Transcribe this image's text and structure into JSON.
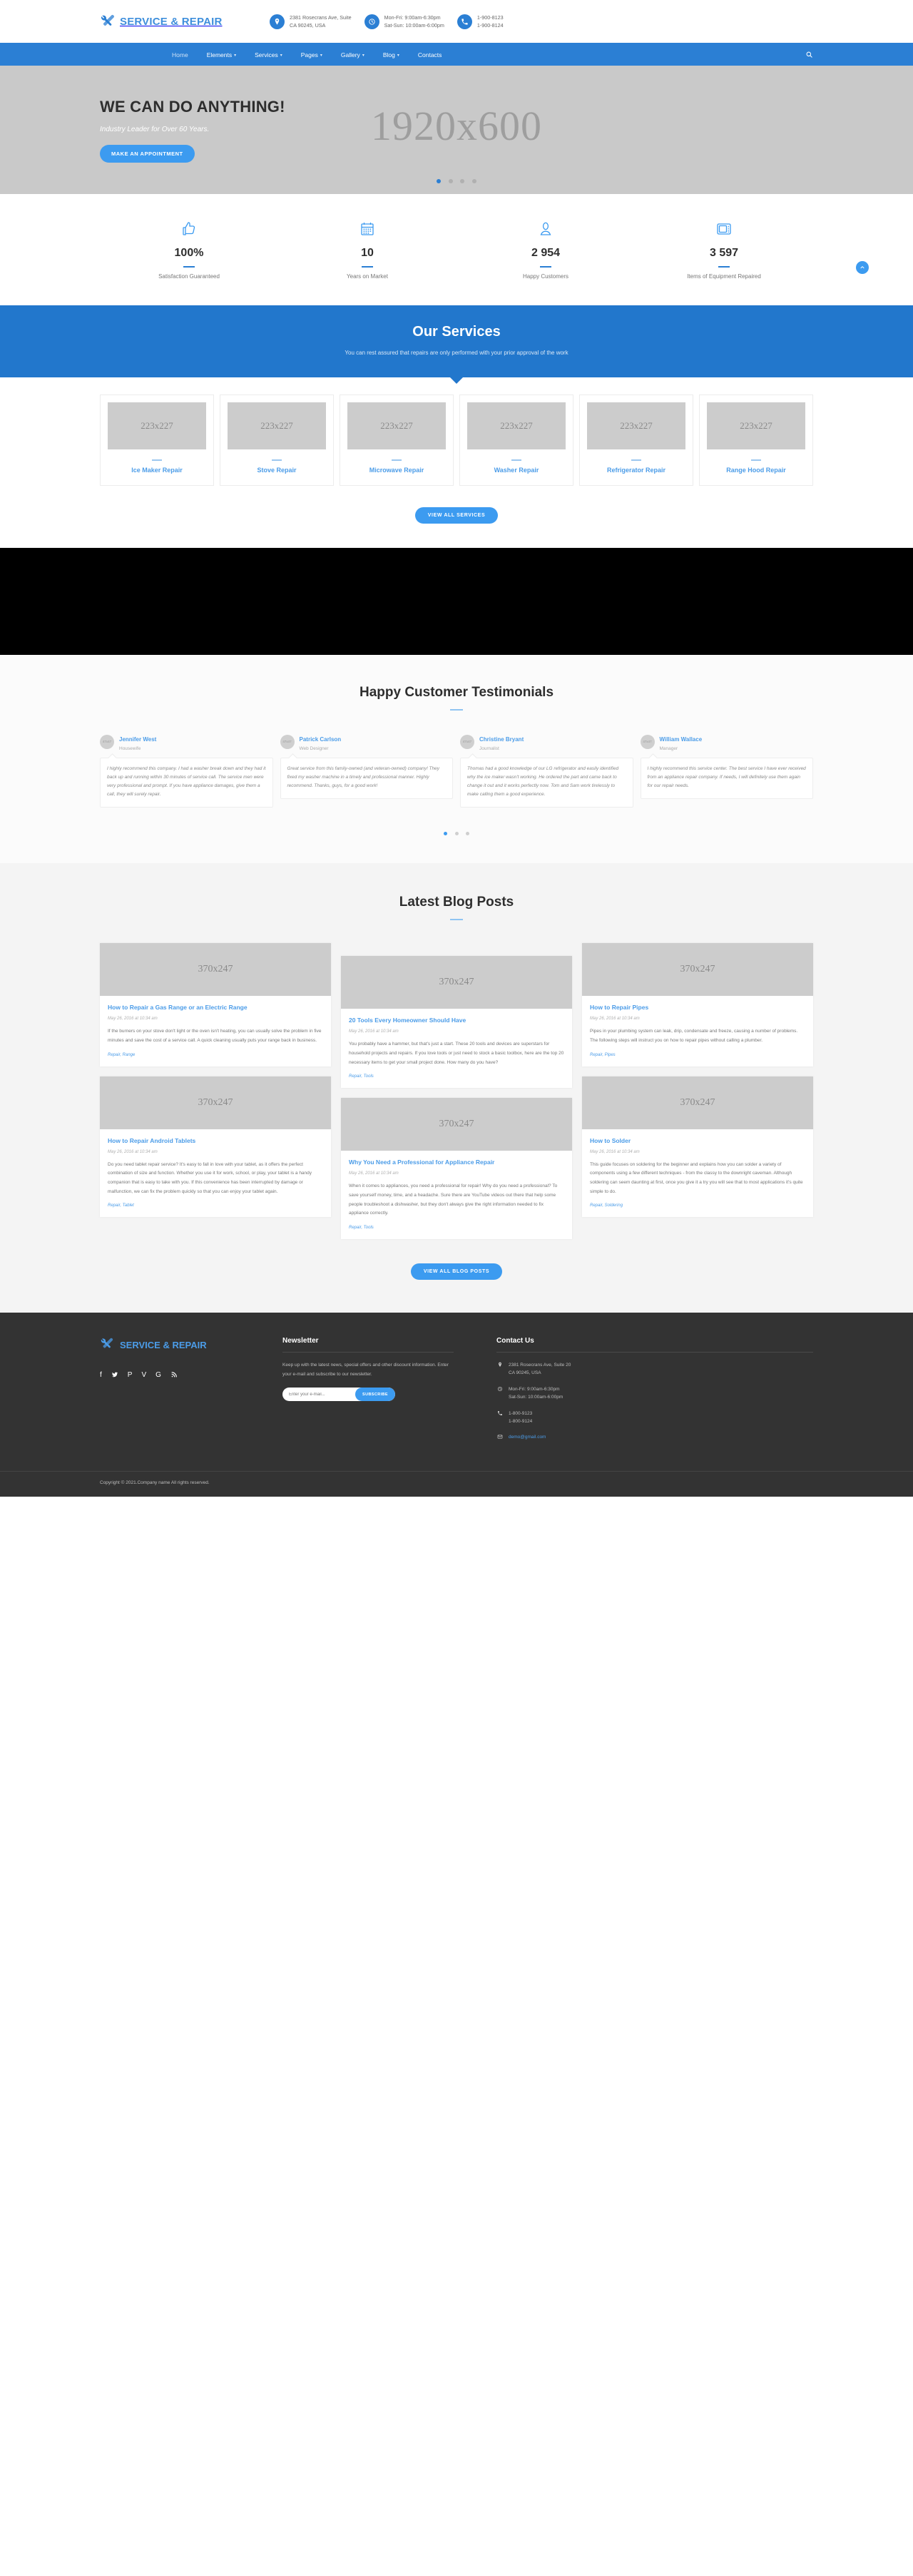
{
  "header": {
    "brand": "SERVICE & REPAIR",
    "contacts": [
      {
        "icon": "location-pin-icon",
        "line1": "2381 Rosecrans Ave, Suite",
        "line2": "CA 90245, USA"
      },
      {
        "icon": "clock-icon",
        "line1": "Mon-Fri: 9:00am-6:30pm",
        "line2": "Sat-Sun: 10:00am-6:00pm"
      },
      {
        "icon": "phone-icon",
        "line1": "1-900-8123",
        "line2": "1-900-8124"
      }
    ]
  },
  "nav": {
    "items": [
      {
        "label": "Home",
        "caret": false,
        "active": true
      },
      {
        "label": "Elements",
        "caret": true,
        "active": false
      },
      {
        "label": "Services",
        "caret": true,
        "active": false
      },
      {
        "label": "Pages",
        "caret": true,
        "active": false
      },
      {
        "label": "Gallery",
        "caret": true,
        "active": false
      },
      {
        "label": "Blog",
        "caret": true,
        "active": false
      },
      {
        "label": "Contacts",
        "caret": false,
        "active": false
      }
    ],
    "search_icon": "search-icon"
  },
  "hero": {
    "placeholder": "1920x600",
    "title": "WE CAN DO ANYTHING!",
    "subtitle": "Industry Leader for Over 60 Years.",
    "cta": "MAKE AN APPOINTMENT",
    "slides": 4,
    "active_slide": 1
  },
  "counters": [
    {
      "icon": "thumbs-up-icon",
      "value": "100%",
      "label": "Satisfaction Guaranteed"
    },
    {
      "icon": "calendar-icon",
      "value": "10",
      "label": "Years on Market"
    },
    {
      "icon": "person-icon",
      "value": "2 954",
      "label": "Happy Customers"
    },
    {
      "icon": "appliance-icon",
      "value": "3 597",
      "label": "Items of Equipment Repaired"
    }
  ],
  "services": {
    "title": "Our Services",
    "subtitle": "You can rest assured that repairs are only performed with your prior approval of the work",
    "thumb_placeholder": "223x227",
    "items": [
      {
        "name": "Ice Maker Repair"
      },
      {
        "name": "Stove Repair"
      },
      {
        "name": "Microwave Repair"
      },
      {
        "name": "Washer Repair"
      },
      {
        "name": "Refrigerator Repair"
      },
      {
        "name": "Range Hood Repair"
      }
    ],
    "cta": "VIEW ALL SERVICES"
  },
  "testimonials": {
    "title": "Happy Customer Testimonials",
    "avatar_placeholder": "47x47",
    "items": [
      {
        "name": "Jennifer West",
        "role": "Housewife",
        "text": "I highly recommend this company. I had a washer break down and they had it back up and running within 30 minutes of service call. The service men were very professional and prompt. If you have appliance damages, give them a call, they will surely repair."
      },
      {
        "name": "Patrick Carlson",
        "role": "Web Designer",
        "text": "Great service from this family-owned (and veteran-owned) company! They fixed my washer machine in a timely and professional manner. Highly recommend. Thanks, guys, for a good work!"
      },
      {
        "name": "Christine Bryant",
        "role": "Journalist",
        "text": "Thomas had a good knowledge of our LG refrigerator and easily identified why the ice maker wasn't working. He ordered the part and came back to change it out and it works perfectly now. Tom and Sam work tirelessly to make calling them a good experience."
      },
      {
        "name": "William Wallace",
        "role": "Manager",
        "text": "I highly recommend this service center. The best service I have ever received from an appliance repair company. If needs, I will definitely use them again for our repair needs."
      }
    ],
    "slides": 3,
    "active_slide": 1
  },
  "blog": {
    "title": "Latest Blog Posts",
    "thumb_placeholder": "370x247",
    "cta": "VIEW ALL BLOG POSTS",
    "posts": [
      {
        "title": "How to Repair a Gas Range or an Electric Range",
        "date": "May 26, 2016 at 10:34 am",
        "text": "If the burners on your stove don't light or the oven isn't heating, you can usually solve the problem in five minutes and save the cost of a service call. A quick cleaning usually puts your range back in business.",
        "tags": "Repair, Range"
      },
      {
        "title": "20 Tools Every Homeowner Should Have",
        "date": "May 26, 2016 at 10:34 am",
        "text": "You probably have a hammer, but that's just a start. These 20 tools and devices are superstars for household projects and repairs. If you love tools or just need to stock a basic toolbox, here are the top 20 necessary items to get your small project done. How many do you have?",
        "tags": "Repair, Tools"
      },
      {
        "title": "How to Repair Pipes",
        "date": "May 26, 2016 at 10:34 am",
        "text": "Pipes in your plumbing system can leak, drip, condensate and freeze, causing a number of problems. The following steps will instruct you on how to repair pipes without calling a plumber.",
        "tags": "Repair, Pipes"
      },
      {
        "title": "How to Repair Android Tablets",
        "date": "May 26, 2016 at 10:34 am",
        "text": "Do you need tablet repair service? It's easy to fall in love with your tablet, as it offers the perfect combination of size and function. Whether you use it for work, school, or play, your tablet is a handy companion that is easy to take with you. If this convenience has been interrupted by damage or malfunction, we can fix the problem quickly so that you can enjoy your tablet again.",
        "tags": "Repair, Tablet"
      },
      {
        "title": "Why You Need a Professional for Appliance Repair",
        "date": "May 26, 2016 at 10:34 am",
        "text": "When it comes to appliances, you need a professional for repair! Why do you need a professional? To save yourself money, time, and a headache. Sure there are YouTube videos out there that help some people troubleshoot a dishwasher, but they don't always give the right information needed to fix appliance correctly.",
        "tags": "Repair, Tools"
      },
      {
        "title": "How to Solder",
        "date": "May 26, 2016 at 10:34 am",
        "text": "This guide focuses on soldering for the beginner and explains how you can solder a variety of components using a few different techniques - from the classy to the downright caveman. Although soldering can seem daunting at first, once you give it a try you will see that to most applications it's quite simple to do.",
        "tags": "Repair, Soldering"
      }
    ]
  },
  "footer": {
    "brand": "SERVICE & REPAIR",
    "socials": [
      "facebook-icon",
      "twitter-icon",
      "pinterest-icon",
      "vimeo-icon",
      "google-plus-icon",
      "rss-icon"
    ],
    "newsletter": {
      "title": "Newsletter",
      "text": "Keep up with the latest news, special offers and other discount information. Enter your e-mail and subscribe to our newsletter.",
      "placeholder": "Enter your e-mail...",
      "button": "SUBSCRIBE"
    },
    "contact": {
      "title": "Contact Us",
      "rows": [
        {
          "icon": "location-pin-icon",
          "line1": "2381 Rosecrans Ave, Suite 20",
          "line2": "CA 90245, USA",
          "link": false
        },
        {
          "icon": "clock-icon",
          "line1": "Mon-Fri: 9:00am-6:30pm",
          "line2": "Sat-Sun: 10:00am-6:00pm",
          "link": false
        },
        {
          "icon": "phone-icon",
          "line1": "1-800-9123",
          "line2": "1-800-9124",
          "link": false
        },
        {
          "icon": "mail-icon",
          "line1": "demo@gmail.com",
          "line2": "",
          "link": true
        }
      ]
    },
    "copyright": "Copyright © 2021.Company name All rights reserved."
  },
  "colors": {
    "brand_blue": "#2b7fd4",
    "accent_blue": "#3c9bf0",
    "link_blue": "#4b9ce8",
    "footer_bg": "#333333"
  }
}
